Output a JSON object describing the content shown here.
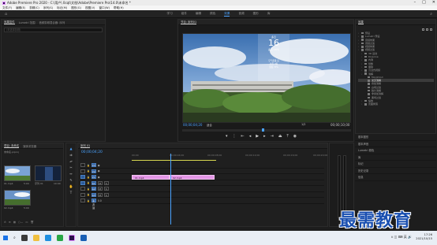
{
  "window": {
    "title": "Adobe Premiere Pro 2020 - C:\\用户\\ 0cqt\\文档\\Adobe\\Premiere Pro\\14.0\\未命名 *"
  },
  "menu": [
    "文件(F)",
    "编辑(E)",
    "剪辑(C)",
    "序列(S)",
    "标记(M)",
    "图形(G)",
    "视图(V)",
    "窗口(W)",
    "帮助(H)"
  ],
  "workspaces": {
    "items": [
      "学习",
      "组件",
      "编辑",
      "颜色",
      "效果",
      "音频",
      "图形",
      "库"
    ],
    "active_index": 4
  },
  "source_panel": {
    "tabs": [
      "效果控件",
      "Lumetri 范围",
      "音频剪辑混合器: 序列"
    ],
    "active_tab": 0,
    "field_placeholder": "(未选择剪辑)"
  },
  "program_monitor": {
    "tab_label": "节目: 序列01",
    "timecode_current": "00;00;04;20",
    "fit_label": "适合",
    "resolution_label": "1/2",
    "timecode_total": "00;00;10;00",
    "overlay_time": "16",
    "overlay_top": "多云",
    "overlay_sub": "多云 18℃",
    "overlay_lines": [
      "空气质量 良",
      "北风 2级",
      "湿度 72%"
    ],
    "controls": [
      "mark-in-icon",
      "mark-out-icon",
      "go-to-in-icon",
      "step-back-icon",
      "play-icon",
      "step-forward-icon",
      "go-to-out-icon",
      "lift-icon",
      "extract-icon",
      "export-frame-icon"
    ]
  },
  "effects_panel": {
    "tab_label": "效果",
    "tree": [
      {
        "label": "预设",
        "level": 0
      },
      {
        "label": "Lumetri 预设",
        "level": 0
      },
      {
        "label": "音频效果",
        "level": 0
      },
      {
        "label": "音频过渡",
        "level": 0
      },
      {
        "label": "视频效果",
        "level": 0
      },
      {
        "label": "视频过渡",
        "level": 0
      },
      {
        "label": "3D 运动",
        "level": 1
      },
      {
        "label": "Dissolve",
        "level": 1
      },
      {
        "label": "内滑",
        "level": 1
      },
      {
        "label": "划像",
        "level": 1
      },
      {
        "label": "擦除",
        "level": 1
      },
      {
        "label": "沉浸式视频",
        "level": 1
      },
      {
        "label": "溶解",
        "level": 1
      },
      {
        "label": "MorphCut",
        "level": 2
      },
      {
        "label": "交叉溶解",
        "level": 2,
        "selected": true
      },
      {
        "label": "叠加溶解",
        "level": 2
      },
      {
        "label": "白场过渡",
        "level": 2
      },
      {
        "label": "胶片溶解",
        "level": 2
      },
      {
        "label": "非叠加溶解",
        "level": 2
      },
      {
        "label": "黑场过渡",
        "level": 2
      },
      {
        "label": "缩放",
        "level": 1
      },
      {
        "label": "页面剥落",
        "level": 1
      }
    ]
  },
  "right_panels": [
    "基本图形",
    "基本声音",
    "Lumetri 颜色",
    "库",
    "标记",
    "历史记录",
    "信息"
  ],
  "project_panel": {
    "tabs": [
      "项目: 未命名",
      "媒体浏览器"
    ],
    "active_tab": 0,
    "filename": "未命名.prproj",
    "items": [
      {
        "name": "01.mp4",
        "duration": "5:00"
      },
      {
        "name": "序列 01",
        "duration": "10:00"
      },
      {
        "name": "02.mp4",
        "duration": "5:00"
      }
    ]
  },
  "tools": [
    "selection-tool-icon",
    "track-select-icon",
    "ripple-edit-icon",
    "razor-icon",
    "slip-icon",
    "pen-icon",
    "hand-icon",
    "type-icon"
  ],
  "timeline": {
    "tab_label": "序列 01",
    "timecode": "00;00;04;20",
    "ruler": [
      "00;00",
      "00;00;04;00",
      "00;00;08;00",
      "00;00;12;00",
      "00;00;16;00",
      "00;00;20;00"
    ],
    "tracks": [
      {
        "id": "V3",
        "kind": "video"
      },
      {
        "id": "V2",
        "kind": "video"
      },
      {
        "id": "V1",
        "kind": "video",
        "clips": [
          {
            "name": "01.mp4"
          },
          {
            "name": "02.mp4"
          }
        ]
      },
      {
        "id": "A1",
        "kind": "audio"
      },
      {
        "id": "A2",
        "kind": "audio"
      },
      {
        "id": "A3",
        "kind": "audio"
      },
      {
        "id": "主声道",
        "kind": "master",
        "value": "0.0"
      }
    ]
  },
  "taskbar": {
    "time": "17:26",
    "date": "2021/10/15",
    "tray_icons": "∧ ◫ ⌨ 英 🔊"
  },
  "watermark": "最需教育",
  "colors": {
    "accent": "#4aa3ff",
    "clip": "#e496e6",
    "panel_bg": "#1f1f1f"
  }
}
